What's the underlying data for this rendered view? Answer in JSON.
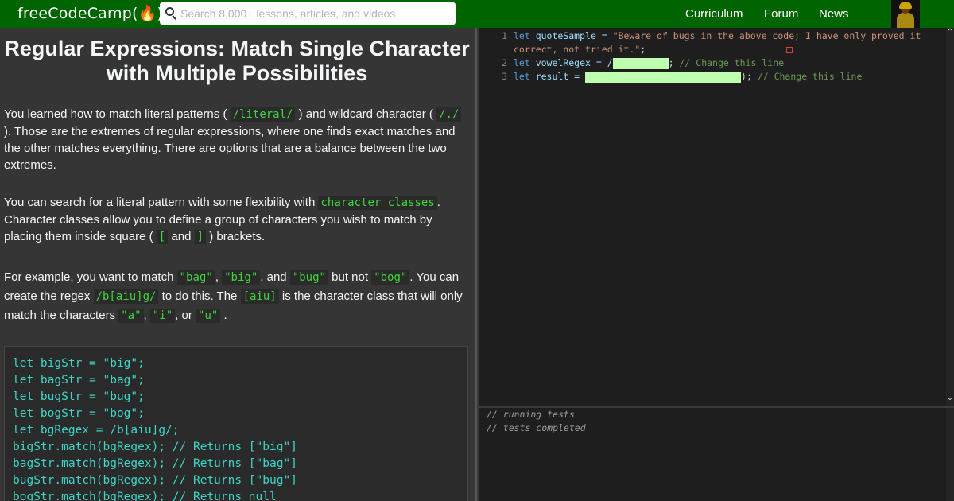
{
  "navbar": {
    "logo_text": "freeCodeCamp(🔥)",
    "search_placeholder": "Search 8,000+ lessons, articles, and videos",
    "links": [
      "Curriculum",
      "Forum",
      "News"
    ]
  },
  "challenge": {
    "title": "Regular Expressions: Match Single Character with Multiple Possibilities",
    "p1": {
      "a": "You learned how to match literal patterns (",
      "c1": "/literal/",
      "b": ") and wildcard character (",
      "c2": "/./",
      "c": "). Those are the extremes of regular expressions, where one finds exact matches and the other matches everything. There are options that are a balance between the two extremes."
    },
    "p2": {
      "a": "You can search for a literal pattern with some flexibility with",
      "c1": "character classes",
      "b": ". Character classes allow you to define a group of characters you wish to match by placing them inside square (",
      "c2": "[",
      "c": "and",
      "c3": "]",
      "d": ") brackets."
    },
    "p3": {
      "a": "For example, you want to match",
      "c1": "\"bag\"",
      "b": ",",
      "c2": "\"big\"",
      "c": ", and",
      "c3": "\"bug\"",
      "d": "but not",
      "c4": "\"bog\"",
      "e": ". You can create the regex",
      "c5": "/b[aiu]g/",
      "f": "to do this. The",
      "c6": "[aiu]",
      "g": "is the character class that will only match the characters",
      "c7": "\"a\"",
      "h": ",",
      "c8": "\"i\"",
      "i": ", or",
      "c9": "\"u\"",
      "j": "."
    },
    "example_code": [
      "let bigStr = \"big\";",
      "let bagStr = \"bag\";",
      "let bugStr = \"bug\";",
      "let bogStr = \"bog\";",
      "let bgRegex = /b[aiu]g/;",
      "bigStr.match(bgRegex); // Returns [\"big\"]",
      "bagStr.match(bgRegex); // Returns [\"bag\"]",
      "bugStr.match(bgRegex); // Returns [\"bug\"]",
      "bogStr.match(bgRegex); // Returns null"
    ]
  },
  "editor": {
    "line_numbers": [
      "1",
      "2",
      "3"
    ],
    "line1_kw": "let",
    "line1_var": " quoteSample = ",
    "line1_str_a": "\"Beware of bugs in the above code; I have only proved it",
    "line1_str_b": "correct, not tried it.\"",
    "line1_end": ";",
    "line2_kw": "let",
    "line2_var": " vowelRegex = /",
    "line2_end": ";",
    "line2_cmt": " // Change this line",
    "line3_kw": "let",
    "line3_var": " result = ",
    "line3_end": ");",
    "line3_cmt": " // Change this line"
  },
  "console": {
    "lines": [
      "// running tests",
      "// tests completed"
    ]
  },
  "icons": {
    "search": "search-icon",
    "scroll_up": "chevron-up-icon",
    "scroll_down": "chevron-down-icon"
  }
}
